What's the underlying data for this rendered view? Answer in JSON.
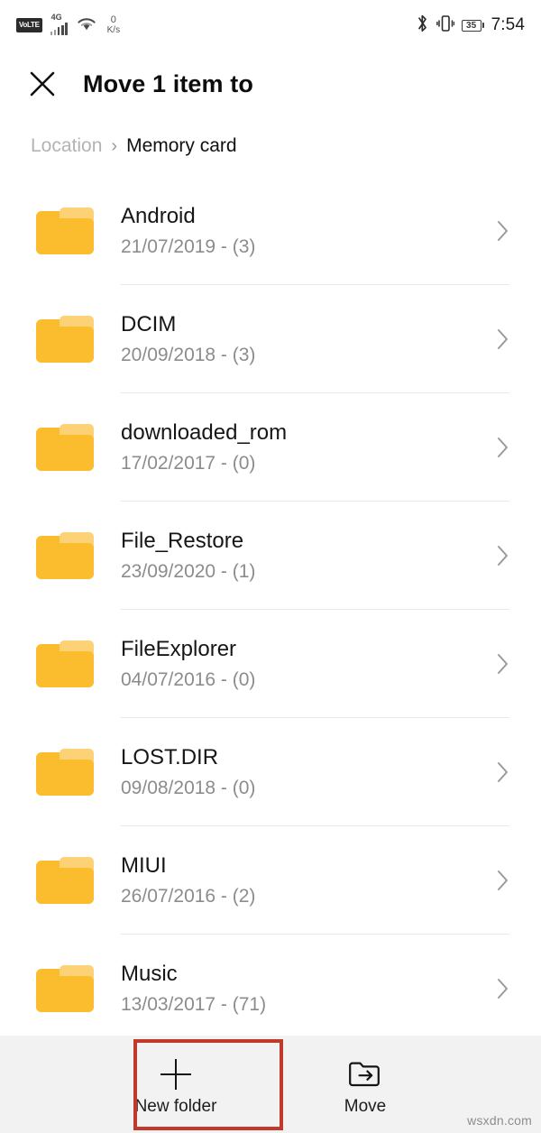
{
  "status_bar": {
    "volte_label": "VoLTE",
    "network_type": "4G",
    "wifi_icon": "wifi-icon",
    "net_speed_value": "0",
    "net_speed_unit": "K/s",
    "bluetooth_icon": "bluetooth-icon",
    "vibrate_icon": "vibrate-icon",
    "battery_level": "35",
    "time": "7:54"
  },
  "header": {
    "close_icon": "close-icon",
    "title": "Move 1 item to"
  },
  "breadcrumb": {
    "root_label": "Location",
    "separator": "›",
    "current_label": "Memory card"
  },
  "file_list": {
    "items": [
      {
        "name": "Android",
        "meta": "21/07/2019 - (3)"
      },
      {
        "name": "DCIM",
        "meta": "20/09/2018 - (3)"
      },
      {
        "name": "downloaded_rom",
        "meta": "17/02/2017 - (0)"
      },
      {
        "name": "File_Restore",
        "meta": "23/09/2020 - (1)"
      },
      {
        "name": "FileExplorer",
        "meta": "04/07/2016 - (0)"
      },
      {
        "name": "LOST.DIR",
        "meta": "09/08/2018 - (0)"
      },
      {
        "name": "MIUI",
        "meta": "26/07/2016 - (2)"
      },
      {
        "name": "Music",
        "meta": "13/03/2017 - (71)"
      }
    ]
  },
  "bottom_bar": {
    "new_folder_label": "New folder",
    "new_folder_icon": "plus-icon",
    "move_label": "Move",
    "move_icon": "folder-move-arrow-icon"
  },
  "annotation": {
    "color": "#C0392B",
    "target": "new-folder-button"
  },
  "watermark": {
    "text": "wsxdn.com"
  },
  "colors": {
    "folder": "#FBBC2E",
    "folder_tab": "#FDD276",
    "bottom_bar_bg": "#F2F2F2",
    "divider": "#E9E9E9",
    "meta_text": "#8C8C8C"
  }
}
